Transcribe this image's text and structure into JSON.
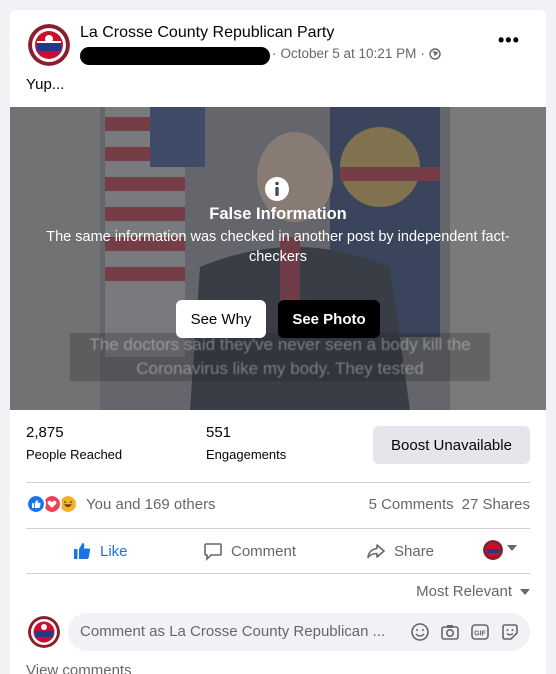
{
  "post": {
    "page_name": "La Crosse County Republican Party",
    "timestamp": "October 5 at 10:21 PM",
    "separator": "·",
    "text": "Yup..."
  },
  "warning": {
    "title": "False Information",
    "body": "The same information was checked in another post by independent fact-checkers",
    "see_why": "See Why",
    "see_photo": "See Photo",
    "caption": "The doctors said they've never seen a body kill the Coronavirus like my body. They tested"
  },
  "insights": {
    "people_reached_value": "2,875",
    "people_reached_label": "People Reached",
    "engagements_value": "551",
    "engagements_label": "Engagements",
    "boost_label": "Boost Unavailable"
  },
  "reactions": {
    "text": "You and 169 others",
    "comments": "5 Comments",
    "shares": "27 Shares"
  },
  "actions": {
    "like": "Like",
    "comment": "Comment",
    "share": "Share"
  },
  "comments": {
    "sort_label": "Most Relevant",
    "placeholder": "Comment as La Crosse County Republican ...",
    "view_more": "View comments"
  },
  "colors": {
    "facebook_blue": "#1b74e4",
    "secondary_text": "#65676b",
    "love_red": "#f33e58",
    "haha_yellow": "#f7b125"
  }
}
